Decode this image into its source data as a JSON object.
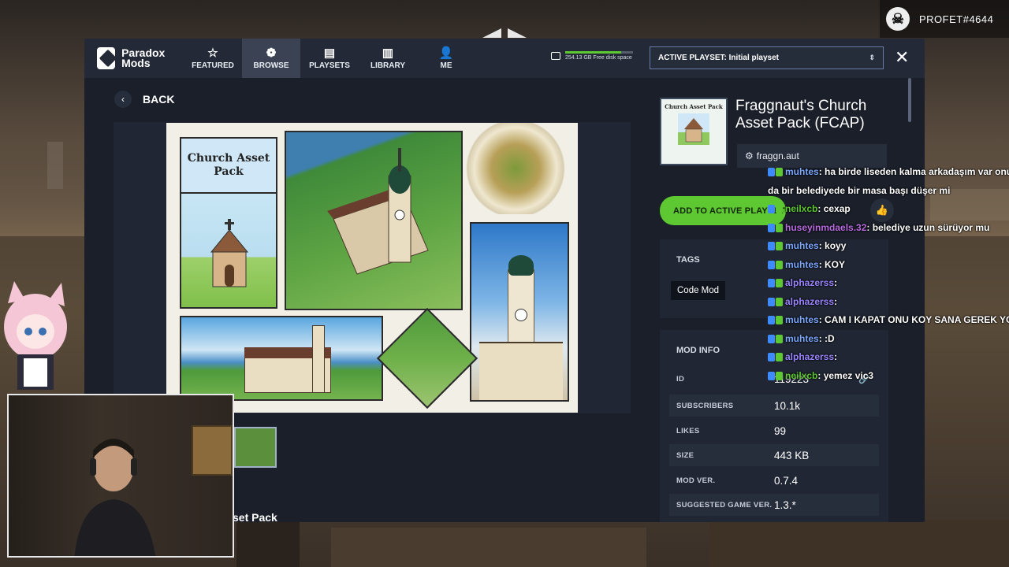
{
  "profile": {
    "name": "PROFET#4644"
  },
  "app": {
    "logo_text": "Paradox Mods",
    "nav": [
      {
        "label": "FEATURED",
        "icon": "star-icon",
        "glyph": "☆"
      },
      {
        "label": "BROWSE",
        "icon": "browse-icon",
        "glyph": "❁"
      },
      {
        "label": "PLAYSETS",
        "icon": "playsets-icon",
        "glyph": "▤"
      },
      {
        "label": "LIBRARY",
        "icon": "library-icon",
        "glyph": "▥"
      },
      {
        "label": "ME",
        "icon": "user-icon",
        "glyph": "👤"
      }
    ],
    "disk_space": "254.13 GB Free disk space",
    "disk_fill_fraction": 0.82,
    "playset_selector": "ACTIVE PLAYSET: Initial playset",
    "accent": "#5ec832"
  },
  "page": {
    "back_label": "BACK",
    "hero_card_title": "Church Asset Pack",
    "title_fragment": "set Pack"
  },
  "mod": {
    "title": "Fraggnaut's Church Asset Pack (FCAP)",
    "thumb_title": "Church Asset Pack",
    "author": "fraggn.aut",
    "add_button": "ADD TO ACTIVE PLAYSET",
    "tags_heading": "TAGS",
    "tags": [
      "Code Mod"
    ],
    "info_heading": "MOD INFO",
    "info": [
      {
        "key": "ID",
        "value": "119223"
      },
      {
        "key": "SUBSCRIBERS",
        "value": "10.1k"
      },
      {
        "key": "LIKES",
        "value": "99"
      },
      {
        "key": "SIZE",
        "value": "443 KB"
      },
      {
        "key": "MOD VER.",
        "value": "0.7.4"
      },
      {
        "key": "SUGGESTED GAME VER.",
        "value": "1.3.*"
      }
    ]
  },
  "chat": [
    {
      "user": "muhtes",
      "color": "#7aa7ff",
      "text": ": ha birde liseden kalma arkadaşım var onu"
    },
    {
      "user": "",
      "color": "#ffffff",
      "text": "da bir belediyede bir masa başı düşer mi"
    },
    {
      "user": "neilxcb",
      "color": "#5ec832",
      "text": ": cexap"
    },
    {
      "user": "huseyinmdaels.32",
      "color": "#b96be0",
      "text": ": belediye uzun sürüyor mu"
    },
    {
      "user": "muhtes",
      "color": "#7aa7ff",
      "text": ": koyy"
    },
    {
      "user": "muhtes",
      "color": "#7aa7ff",
      "text": ": KOY"
    },
    {
      "user": "alphazerss",
      "color": "#9a86ff",
      "text": ":"
    },
    {
      "user": "alphazerss",
      "color": "#9a86ff",
      "text": ":"
    },
    {
      "user": "muhtes",
      "color": "#7aa7ff",
      "text": ": CAM I KAPAT ONU KOY SANA GEREK YOK"
    },
    {
      "user": "muhtes",
      "color": "#7aa7ff",
      "text": ": :D"
    },
    {
      "user": "alphazerss",
      "color": "#9a86ff",
      "text": ":"
    },
    {
      "user": "neilxcb",
      "color": "#5ec832",
      "text": ": yemez vic3"
    }
  ]
}
